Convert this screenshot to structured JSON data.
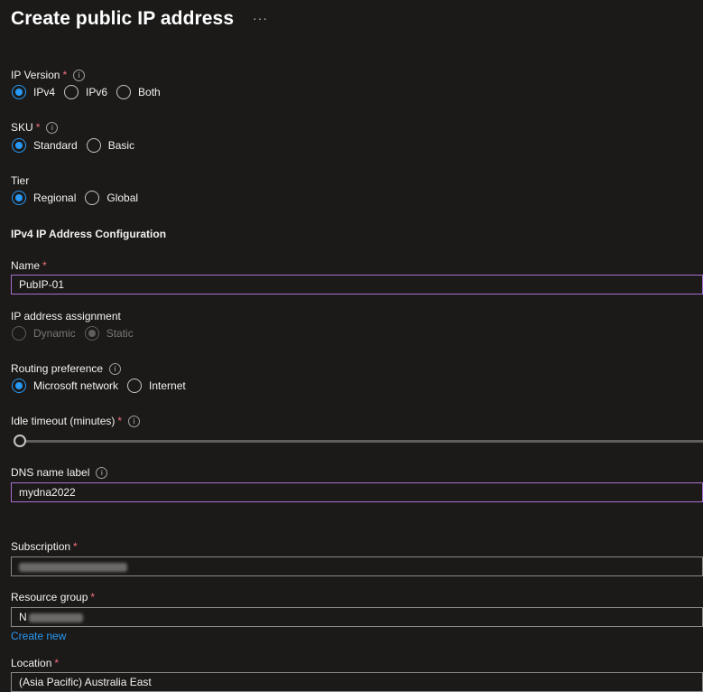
{
  "page": {
    "title": "Create public IP address",
    "more": "···"
  },
  "ip_version": {
    "label": "IP Version",
    "required": "*",
    "options": [
      "IPv4",
      "IPv6",
      "Both"
    ],
    "selected": "IPv4"
  },
  "sku": {
    "label": "SKU",
    "required": "*",
    "options": [
      "Standard",
      "Basic"
    ],
    "selected": "Standard"
  },
  "tier": {
    "label": "Tier",
    "options": [
      "Regional",
      "Global"
    ],
    "selected": "Regional"
  },
  "config_heading": "IPv4 IP Address Configuration",
  "name": {
    "label": "Name",
    "required": "*",
    "value": "PubIP-01"
  },
  "ip_assignment": {
    "label": "IP address assignment",
    "options": [
      "Dynamic",
      "Static"
    ],
    "selected": "Static",
    "disabled": true
  },
  "routing": {
    "label": "Routing preference",
    "options": [
      "Microsoft network",
      "Internet"
    ],
    "selected": "Microsoft network"
  },
  "idle_timeout": {
    "label": "Idle timeout (minutes)",
    "required": "*",
    "value_fraction": 0
  },
  "dns": {
    "label": "DNS name label",
    "value": "mydna2022"
  },
  "subscription": {
    "label": "Subscription",
    "required": "*"
  },
  "resource_group": {
    "label": "Resource group",
    "required": "*",
    "value_prefix": "N",
    "create_new": "Create new"
  },
  "location": {
    "label": "Location",
    "required": "*",
    "value": "(Asia Pacific) Australia East"
  },
  "colors": {
    "accent": "#2899f5",
    "focus_border": "#a86fce",
    "required": "#f1707b",
    "background": "#1b1a19"
  },
  "icons": {
    "info": "info-icon",
    "more": "more-icon"
  }
}
